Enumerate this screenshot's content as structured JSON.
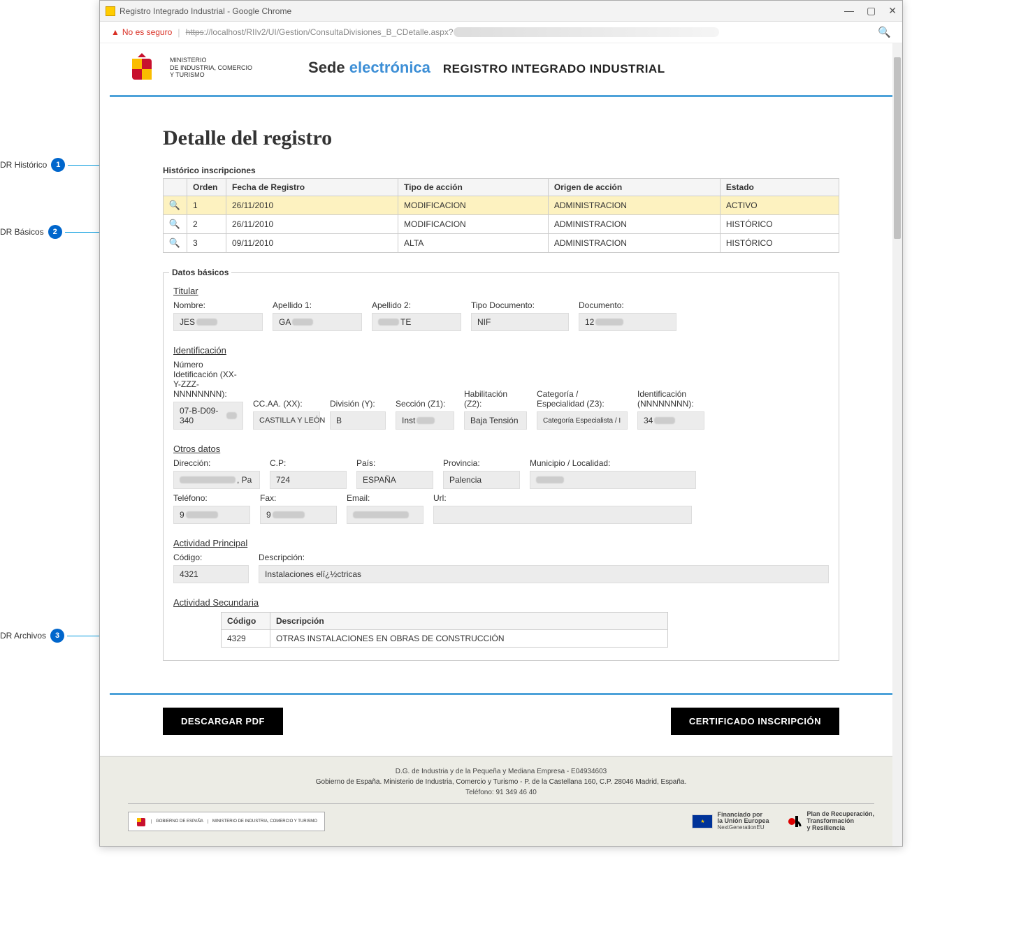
{
  "annotations": {
    "a1": {
      "label": "DR Histórico",
      "num": "1"
    },
    "a2": {
      "label": "DR Básicos",
      "num": "2"
    },
    "a3": {
      "label": "DR Archivos",
      "num": "3"
    }
  },
  "browser": {
    "title": "Registro Integrado Industrial - Google Chrome",
    "insecure": "No es seguro",
    "url_prefix_struck": "https",
    "url_rest": "://localhost/RIIv2/UI/Gestion/ConsultaDivisiones_B_CDetalle.aspx?"
  },
  "header": {
    "ministerio_l1": "MINISTERIO",
    "ministerio_l2": "DE INDUSTRIA, COMERCIO",
    "ministerio_l3": "Y TURISMO",
    "sede1": "Sede",
    "sede2": "electrónica",
    "rii": "REGISTRO INTEGRADO INDUSTRIAL"
  },
  "page_title": "Detalle del registro",
  "hist": {
    "label": "Histórico inscripciones",
    "cols": {
      "orden": "Orden",
      "fecha": "Fecha de Registro",
      "tipo": "Tipo de acción",
      "origen": "Origen de acción",
      "estado": "Estado"
    },
    "rows": [
      {
        "orden": "1",
        "fecha": "26/11/2010",
        "tipo": "MODIFICACION",
        "origen": "ADMINISTRACION",
        "estado": "ACTIVO",
        "selected": true
      },
      {
        "orden": "2",
        "fecha": "26/11/2010",
        "tipo": "MODIFICACION",
        "origen": "ADMINISTRACION",
        "estado": "HISTÓRICO",
        "selected": false
      },
      {
        "orden": "3",
        "fecha": "09/11/2010",
        "tipo": "ALTA",
        "origen": "ADMINISTRACION",
        "estado": "HISTÓRICO",
        "selected": false
      }
    ]
  },
  "basicos": {
    "legend": "Datos básicos",
    "titular": {
      "head": "Titular",
      "nombre_l": "Nombre:",
      "nombre_v": "JES",
      "ap1_l": "Apellido 1:",
      "ap1_v": "GA",
      "ap2_l": "Apellido 2:",
      "ap2_v": "TE",
      "tipodoc_l": "Tipo Documento:",
      "tipodoc_v": "NIF",
      "doc_l": "Documento:",
      "doc_v": "12"
    },
    "ident": {
      "head": "Identificación",
      "numid_l": "Número Idetificación (XX-Y-ZZZ-NNNNNNNN):",
      "numid_v": "07-B-D09-340",
      "ccaa_l": "CC.AA. (XX):",
      "ccaa_v": "CASTILLA Y LEÓN",
      "div_l": "División (Y):",
      "div_v": "B",
      "sec_l": "Sección (Z1):",
      "sec_v": "Inst",
      "hab_l": "Habilitación (Z2):",
      "hab_v": "Baja Tensión",
      "cat_l": "Categoría / Especialidad (Z3):",
      "cat_v": "Categoría Especialista / I",
      "idnum_l": "Identificación (NNNNNNNN):",
      "idnum_v": "34"
    },
    "otros": {
      "head": "Otros datos",
      "dir_l": "Dirección:",
      "dir_v": ", Pa",
      "cp_l": "C.P:",
      "cp_v": "724",
      "pais_l": "País:",
      "pais_v": "ESPAÑA",
      "prov_l": "Provincia:",
      "prov_v": "Palencia",
      "mun_l": "Municipio / Localidad:",
      "mun_v": "",
      "tel_l": "Teléfono:",
      "tel_v": "9",
      "fax_l": "Fax:",
      "fax_v": "9",
      "email_l": "Email:",
      "email_v": "",
      "url_l": "Url:",
      "url_v": ""
    },
    "actprin": {
      "head": "Actividad Principal",
      "cod_l": "Código:",
      "cod_v": "4321",
      "desc_l": "Descripción:",
      "desc_v": "Instalaciones elï¿½ctricas"
    },
    "actsec": {
      "head": "Actividad Secundaria",
      "cols": {
        "cod": "Código",
        "desc": "Descripción"
      },
      "row": {
        "cod": "4329",
        "desc": "OTRAS INSTALACIONES EN OBRAS DE CONSTRUCCIÓN"
      }
    }
  },
  "buttons": {
    "pdf": "DESCARGAR PDF",
    "cert": "CERTIFICADO INSCRIPCIÓN"
  },
  "footer": {
    "l1": "D.G. de Industria y de la Pequeña y Mediana Empresa - E04934603",
    "l2": "Gobierno de España. Ministerio de Industria, Comercio y Turismo - P. de la Castellana 160, C.P. 28046 Madrid, España.",
    "l3": "Teléfono: 91 349 46 40",
    "gob": "GOBIERNO DE ESPAÑA",
    "min": "MINISTERIO DE INDUSTRIA, COMERCIO Y TURISMO",
    "eu1": "Financiado por",
    "eu2": "la Unión Europea",
    "eu3": "NextGenerationEU",
    "prt1": "Plan de Recuperación,",
    "prt2": "Transformación",
    "prt3": "y Resiliencia"
  }
}
